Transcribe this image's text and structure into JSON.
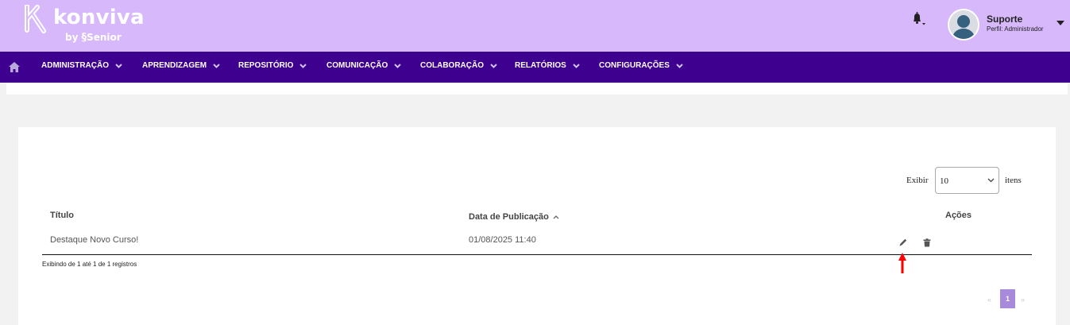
{
  "brand": {
    "name": "konviva",
    "by_text": "by",
    "company": "Senior"
  },
  "header": {
    "notifications_icon": "bell-icon",
    "user": {
      "name": "Suporte",
      "role": "Perfil: Administrador",
      "avatar_icon": "user-silhouette-icon"
    }
  },
  "nav": {
    "home_icon": "home-icon",
    "items": [
      {
        "label": "ADMINISTRAÇÃO"
      },
      {
        "label": "APRENDIZAGEM"
      },
      {
        "label": "REPOSITÓRIO"
      },
      {
        "label": "COMUNICAÇÃO"
      },
      {
        "label": "COLABORAÇÃO"
      },
      {
        "label": "RELATÓRIOS"
      },
      {
        "label": "CONFIGURAÇÕES"
      }
    ]
  },
  "table_controls": {
    "show_label": "Exibir",
    "page_size": "10",
    "items_label": "itens"
  },
  "table": {
    "columns": [
      "Título",
      "Data de Publicação",
      "Ações"
    ],
    "sorted_column": "Data de Publicação",
    "sort_direction": "ascending",
    "rows": [
      {
        "title": "Destaque Novo Curso!",
        "date": "01/08/2025 11:40",
        "actions": [
          "edit",
          "delete"
        ]
      }
    ],
    "info": "Exibindo de 1 até 1 de 1 registros"
  },
  "pagination": {
    "first": "«",
    "current": "1",
    "last": "»"
  },
  "colors": {
    "topbar": "#d6b8fb",
    "navbar": "#3e008f",
    "page_active": "#a78bda",
    "annotation_arrow": "#ff0000"
  }
}
